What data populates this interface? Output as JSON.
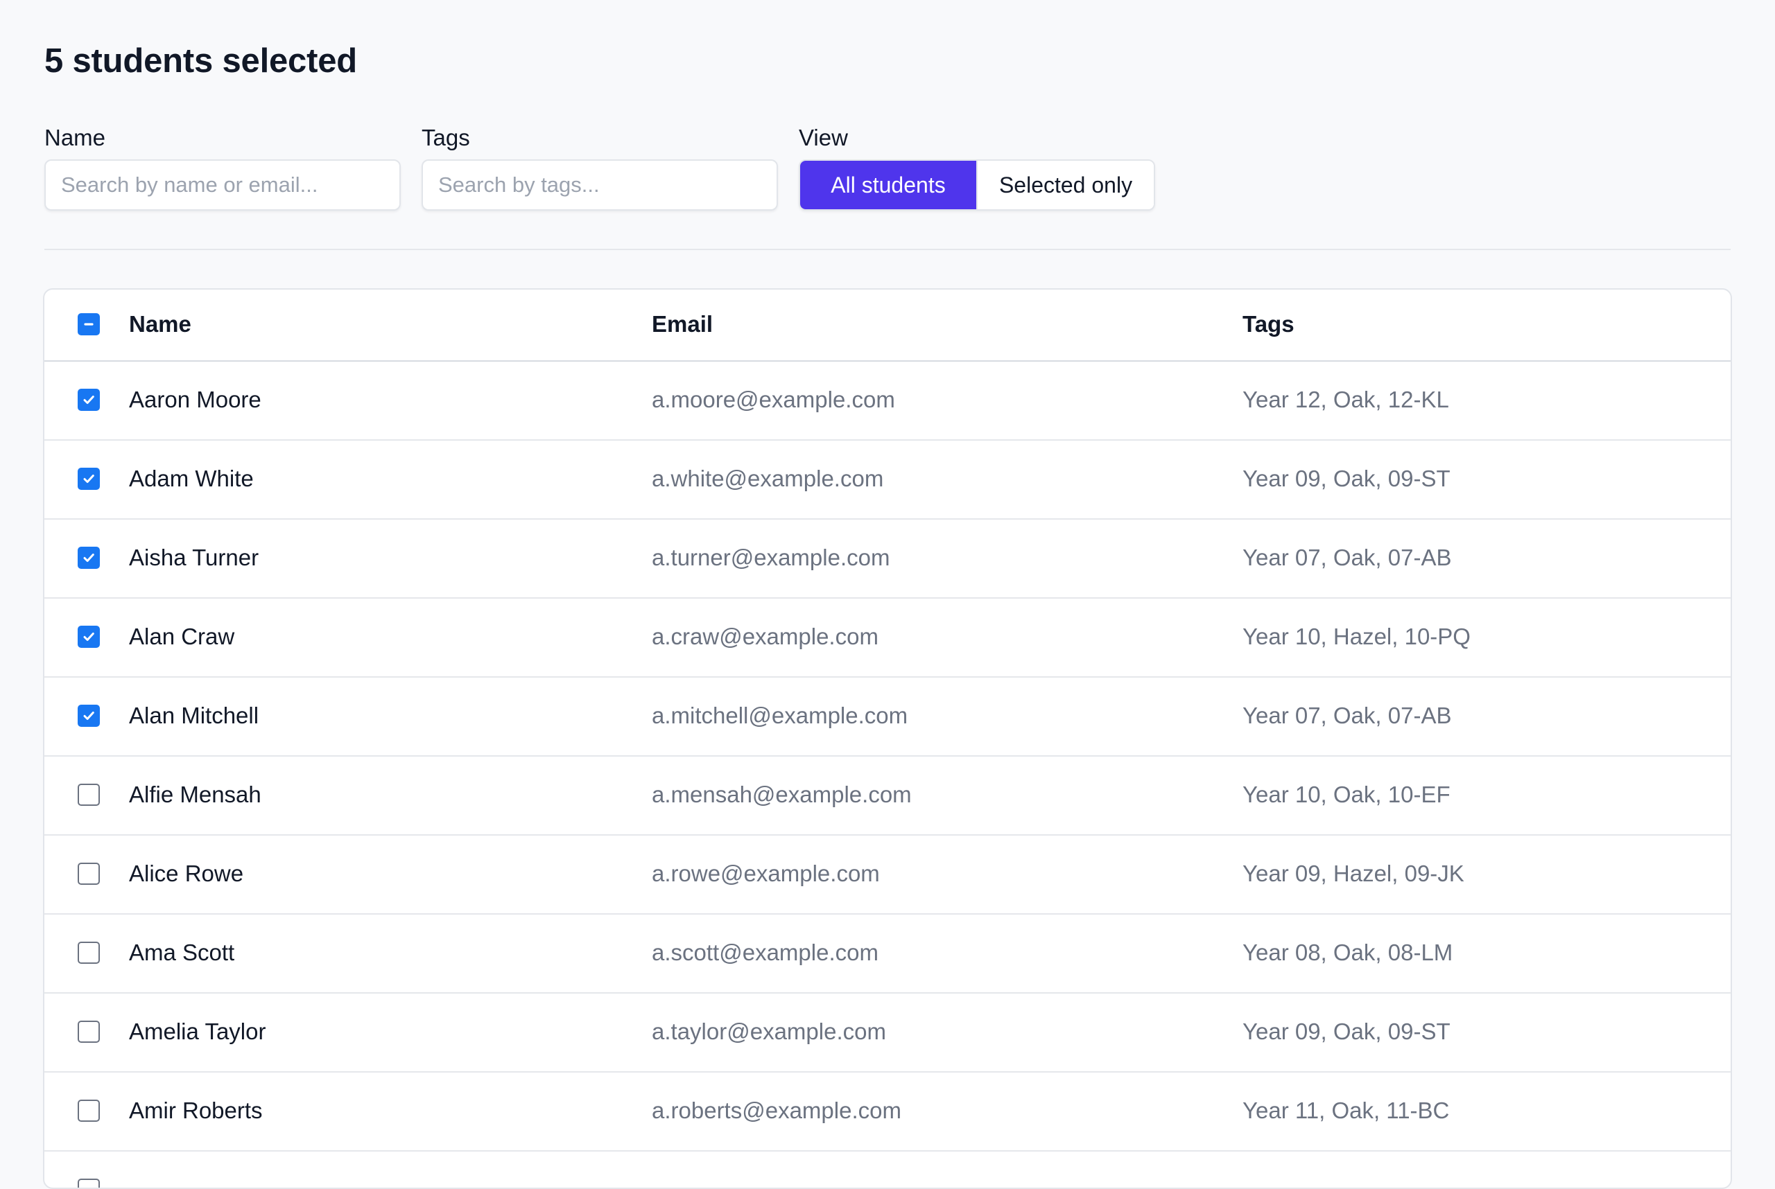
{
  "page": {
    "title": "5 students selected"
  },
  "filters": {
    "name": {
      "label": "Name",
      "placeholder": "Search by name or email...",
      "value": ""
    },
    "tags": {
      "label": "Tags",
      "placeholder": "Search by tags...",
      "value": ""
    },
    "view": {
      "label": "View",
      "options": [
        "All students",
        "Selected only"
      ],
      "selected": "All students"
    }
  },
  "table": {
    "columns": [
      "Name",
      "Email",
      "Tags"
    ],
    "select_all_state": "indeterminate",
    "rows": [
      {
        "selected": true,
        "name": "Aaron Moore",
        "email": "a.moore@example.com",
        "tags": "Year 12, Oak, 12-KL"
      },
      {
        "selected": true,
        "name": "Adam White",
        "email": "a.white@example.com",
        "tags": "Year 09, Oak, 09-ST"
      },
      {
        "selected": true,
        "name": "Aisha Turner",
        "email": "a.turner@example.com",
        "tags": "Year 07, Oak, 07-AB"
      },
      {
        "selected": true,
        "name": "Alan Craw",
        "email": "a.craw@example.com",
        "tags": "Year 10, Hazel, 10-PQ"
      },
      {
        "selected": true,
        "name": "Alan Mitchell",
        "email": "a.mitchell@example.com",
        "tags": "Year 07, Oak, 07-AB"
      },
      {
        "selected": false,
        "name": "Alfie Mensah",
        "email": "a.mensah@example.com",
        "tags": "Year 10, Oak, 10-EF"
      },
      {
        "selected": false,
        "name": "Alice Rowe",
        "email": "a.rowe@example.com",
        "tags": "Year 09, Hazel, 09-JK"
      },
      {
        "selected": false,
        "name": "Ama Scott",
        "email": "a.scott@example.com",
        "tags": "Year 08, Oak, 08-LM"
      },
      {
        "selected": false,
        "name": "Amelia Taylor",
        "email": "a.taylor@example.com",
        "tags": "Year 09, Oak, 09-ST"
      },
      {
        "selected": false,
        "name": "Amir Roberts",
        "email": "a.roberts@example.com",
        "tags": "Year 11, Oak, 11-BC"
      },
      {
        "selected": false,
        "name": "",
        "email": "",
        "tags": ""
      }
    ]
  },
  "colors": {
    "background": "#f8f9fb",
    "accent": "#4f35ec",
    "checkbox": "#1877f2",
    "text": "#111827",
    "muted_text": "#6b7280",
    "border": "#e2e5ea"
  },
  "icons": {
    "checked": "checkmark-icon",
    "indeterminate": "minus-icon"
  }
}
